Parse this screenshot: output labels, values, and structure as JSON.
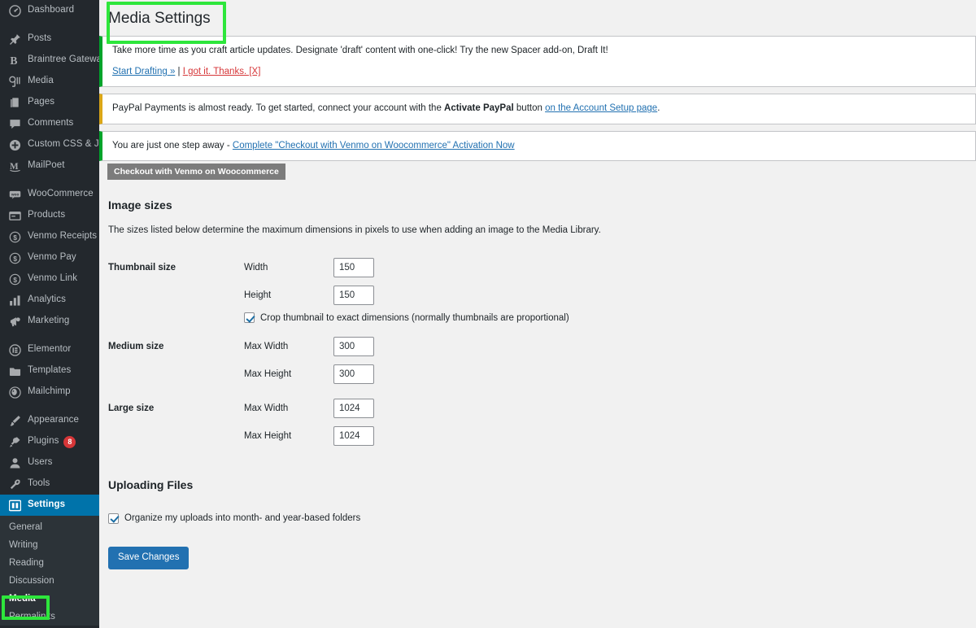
{
  "sidebar": {
    "groups": [
      {
        "items": [
          {
            "label": "Dashboard",
            "icon": "dashboard-icon"
          }
        ]
      },
      {
        "items": [
          {
            "label": "Posts",
            "icon": "pin-icon"
          },
          {
            "label": "Braintree Gateway",
            "icon": "braintree-icon"
          },
          {
            "label": "Media",
            "icon": "media-icon"
          },
          {
            "label": "Pages",
            "icon": "pages-icon"
          },
          {
            "label": "Comments",
            "icon": "comments-icon"
          },
          {
            "label": "Custom CSS & JS",
            "icon": "plus-circle-icon"
          },
          {
            "label": "MailPoet",
            "icon": "mailpoet-icon"
          }
        ]
      },
      {
        "items": [
          {
            "label": "WooCommerce",
            "icon": "woocommerce-icon"
          },
          {
            "label": "Products",
            "icon": "products-icon"
          },
          {
            "label": "Venmo Receipts",
            "icon": "dollar-circle-icon"
          },
          {
            "label": "Venmo Pay",
            "icon": "dollar-circle-icon"
          },
          {
            "label": "Venmo Link",
            "icon": "dollar-circle-icon"
          },
          {
            "label": "Analytics",
            "icon": "analytics-icon"
          },
          {
            "label": "Marketing",
            "icon": "megaphone-icon"
          }
        ]
      },
      {
        "items": [
          {
            "label": "Elementor",
            "icon": "elementor-icon"
          },
          {
            "label": "Templates",
            "icon": "folder-icon"
          },
          {
            "label": "Mailchimp",
            "icon": "mailchimp-icon"
          }
        ]
      },
      {
        "items": [
          {
            "label": "Appearance",
            "icon": "brush-icon"
          },
          {
            "label": "Plugins",
            "icon": "plug-icon",
            "badge": "8"
          },
          {
            "label": "Users",
            "icon": "user-icon"
          },
          {
            "label": "Tools",
            "icon": "wrench-icon"
          }
        ]
      }
    ],
    "settings": {
      "label": "Settings",
      "icon": "settings-icon"
    },
    "submenu": [
      {
        "label": "General",
        "current": false
      },
      {
        "label": "Writing",
        "current": false
      },
      {
        "label": "Reading",
        "current": false
      },
      {
        "label": "Discussion",
        "current": false
      },
      {
        "label": "Media",
        "current": true
      },
      {
        "label": "Permalinks",
        "current": false
      }
    ]
  },
  "page": {
    "title": "Media Settings"
  },
  "notices": {
    "draft_it": {
      "text": "Take more time as you craft article updates. Designate 'draft' content with one-click! Try the new Spacer add-on, Draft It!",
      "link_primary": "Start Drafting »",
      "separator": " | ",
      "link_dismiss": "I got it. Thanks. [X]"
    },
    "paypal": {
      "text_before": "PayPal Payments is almost ready. To get started, connect your account with the ",
      "bold": "Activate PayPal",
      "text_middle": " button ",
      "link": "on the Account Setup page",
      "text_after": "."
    },
    "venmo": {
      "text_before": "You are just one step away - ",
      "link": "Complete \"Checkout with Venmo on Woocommerce\" Activation Now",
      "tooltip": "Checkout with Venmo on Woocommerce"
    }
  },
  "image_sizes": {
    "heading": "Image sizes",
    "description": "The sizes listed below determine the maximum dimensions in pixels to use when adding an image to the Media Library.",
    "rows": [
      {
        "name": "Thumbnail size",
        "fields": [
          {
            "label": "Width",
            "value": "150"
          },
          {
            "label": "Height",
            "value": "150"
          }
        ],
        "checkbox": {
          "label": "Crop thumbnail to exact dimensions (normally thumbnails are proportional)",
          "checked": true
        }
      },
      {
        "name": "Medium size",
        "fields": [
          {
            "label": "Max Width",
            "value": "300"
          },
          {
            "label": "Max Height",
            "value": "300"
          }
        ]
      },
      {
        "name": "Large size",
        "fields": [
          {
            "label": "Max Width",
            "value": "1024"
          },
          {
            "label": "Max Height",
            "value": "1024"
          }
        ]
      }
    ]
  },
  "uploading_files": {
    "heading": "Uploading Files",
    "checkbox": {
      "label": "Organize my uploads into month- and year-based folders",
      "checked": true
    }
  },
  "actions": {
    "save_label": "Save Changes"
  },
  "colors": {
    "sidebar_bg": "#23282d",
    "sidebar_submenu_bg": "#2c3338",
    "active_blue": "#0073aa",
    "button_blue": "#2271b1",
    "notice_green": "#00a32a",
    "notice_amber": "#dba617",
    "badge_red": "#d63638",
    "annotation_green": "#2ee63c",
    "link_blue": "#2271b1",
    "dismiss_red": "#d63638"
  }
}
